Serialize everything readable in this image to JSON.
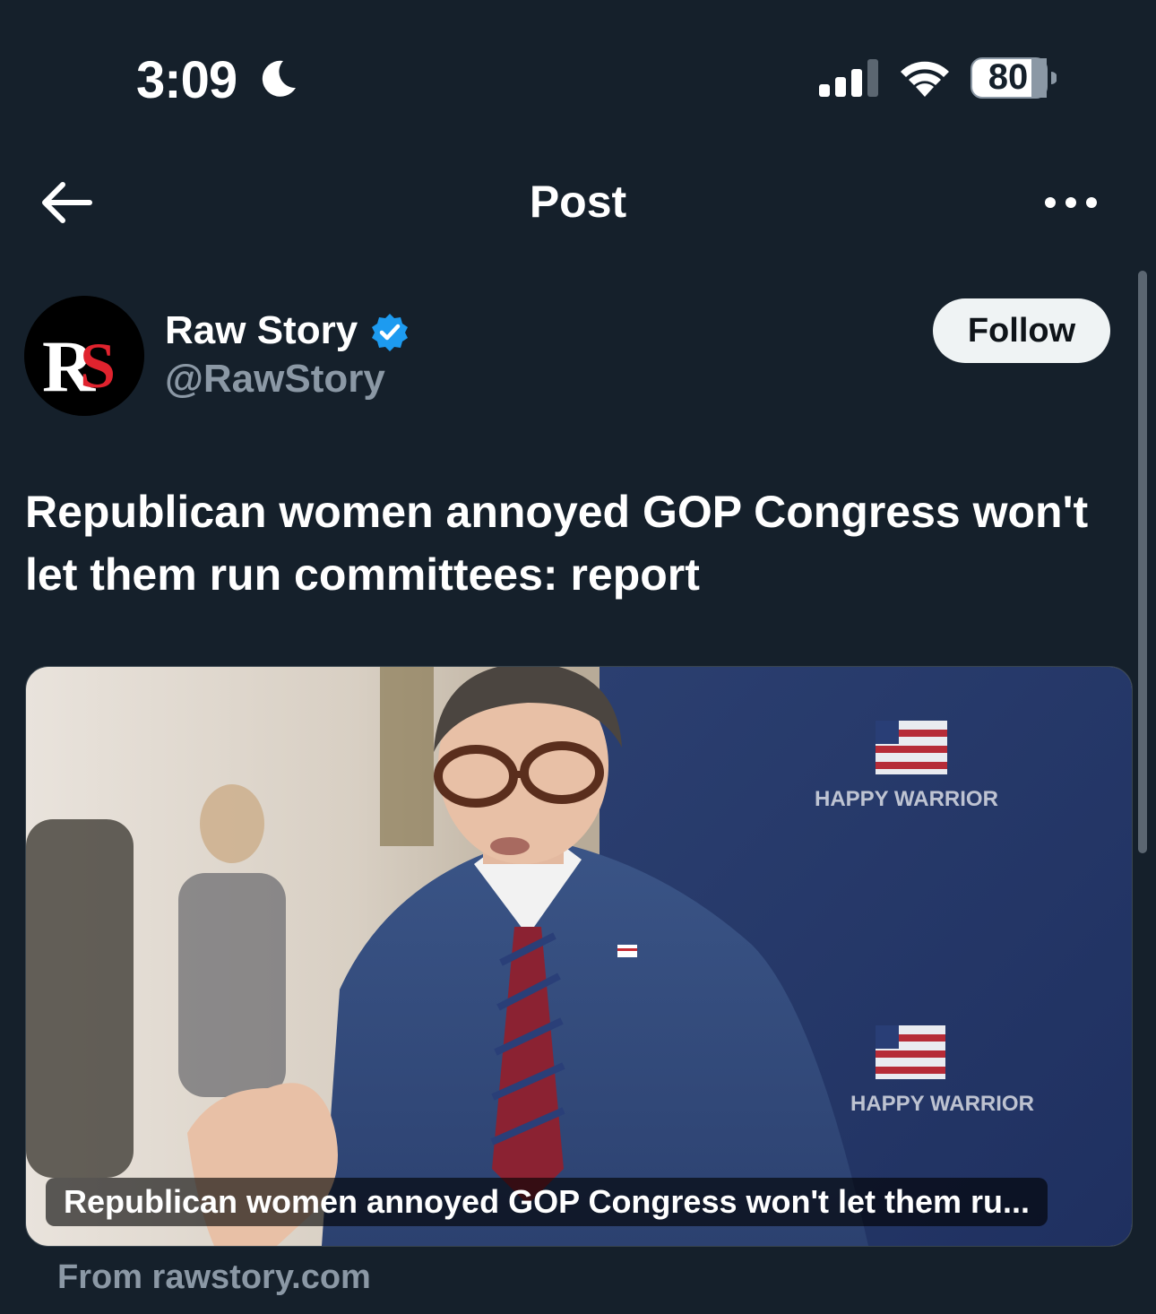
{
  "status_bar": {
    "time": "3:09",
    "battery_level": "80",
    "icons": [
      "moon-icon",
      "cellular-signal-icon",
      "wifi-icon",
      "battery-icon"
    ]
  },
  "nav": {
    "title": "Post",
    "back_icon": "arrow-left-icon",
    "more_icon": "more-horizontal-icon"
  },
  "author": {
    "name": "Raw Story",
    "handle": "@RawStory",
    "verified": true,
    "avatar_logo_text": "RS",
    "follow_label": "Follow"
  },
  "post": {
    "text": "Republican women annoyed GOP Congress won't let them run committees: report"
  },
  "link_card": {
    "caption": "Republican women annoyed GOP Congress won't let them ru...",
    "backdrop_text": "HAPPY WARRIOR",
    "source": "From rawstory.com"
  },
  "colors": {
    "background": "#15202b",
    "text_primary": "#ffffff",
    "text_secondary": "#8b98a5",
    "verified_blue": "#1d9bf0",
    "follow_bg": "#eff3f4"
  }
}
